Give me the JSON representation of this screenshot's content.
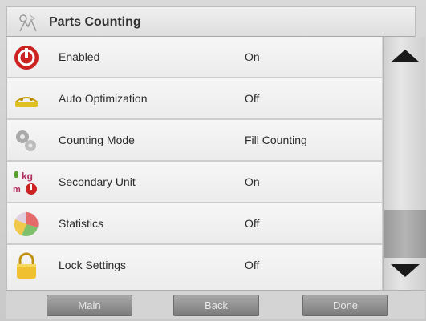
{
  "header": {
    "title": "Parts Counting"
  },
  "rows": [
    {
      "label": "Enabled",
      "value": "On",
      "icon": "power-icon"
    },
    {
      "label": "Auto Optimization",
      "value": "Off",
      "icon": "scale-optimize-icon"
    },
    {
      "label": "Counting Mode",
      "value": "Fill Counting",
      "icon": "gears-icon"
    },
    {
      "label": "Secondary Unit",
      "value": "On",
      "icon": "kg-unit-icon"
    },
    {
      "label": "Statistics",
      "value": "Off",
      "icon": "pie-chart-icon"
    },
    {
      "label": "Lock Settings",
      "value": "Off",
      "icon": "padlock-icon"
    }
  ],
  "footer": {
    "main_label": "Main",
    "back_label": "Back",
    "done_label": "Done"
  },
  "colors": {
    "accent_red": "#cc2222",
    "button_gray": "#8c8c8c",
    "scroll_arrow": "#1a1a1a"
  }
}
